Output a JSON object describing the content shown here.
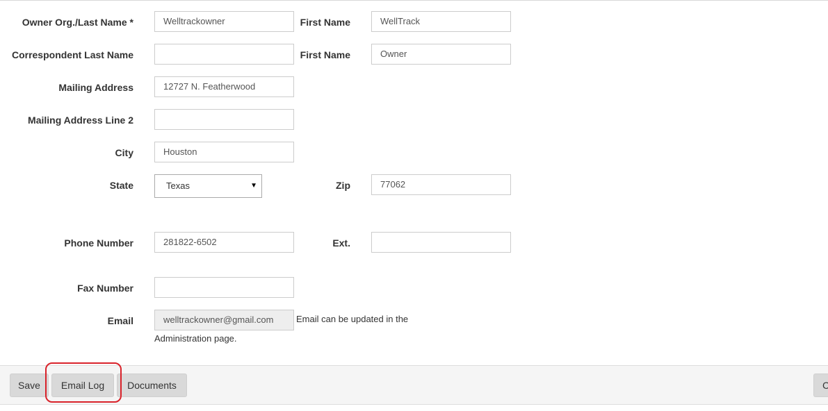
{
  "form": {
    "owner_last_label": "Owner Org./Last Name *",
    "owner_last_value": "Welltrackowner",
    "owner_first_label": "First Name",
    "owner_first_value": "WellTrack",
    "corr_last_label": "Correspondent Last Name",
    "corr_last_value": "",
    "corr_first_label": "First Name",
    "corr_first_value": "Owner",
    "mailing_label": "Mailing Address",
    "mailing_value": "12727 N. Featherwood",
    "mailing2_label": "Mailing Address Line 2",
    "mailing2_value": "",
    "city_label": "City",
    "city_value": "Houston",
    "state_label": "State",
    "state_value": "Texas",
    "zip_label": "Zip",
    "zip_value": "77062",
    "phone_label": "Phone Number",
    "phone_value": "281822-6502",
    "ext_label": "Ext.",
    "ext_value": "",
    "fax_label": "Fax Number",
    "fax_value": "",
    "email_label": "Email",
    "email_value": "welltrackowner@gmail.com",
    "email_note_line1": "Email can be updated in the",
    "email_note_line2": "Administration page."
  },
  "footer": {
    "save_label": "Save",
    "email_log_label": "Email Log",
    "documents_label": "Documents",
    "right_button_label": "C"
  },
  "colors": {
    "highlight": "#d9222a",
    "button_bg": "#d9d9d9",
    "footer_bg": "#f5f5f5"
  }
}
